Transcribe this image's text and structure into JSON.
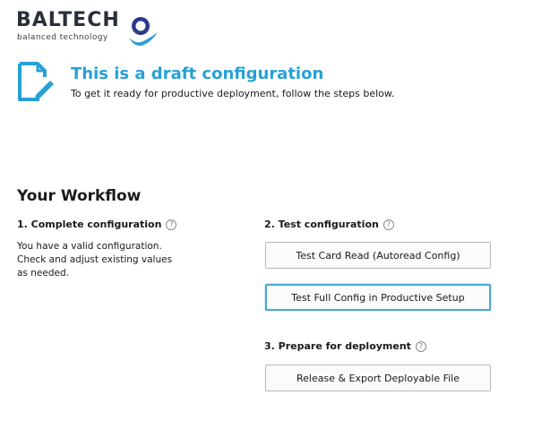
{
  "logo": {
    "name": "BALTECH",
    "tagline": "balanced technology"
  },
  "draft": {
    "title": "This is a draft configuration",
    "subtitle": "To get it ready for productive deployment, follow the steps below.",
    "icon": "edit-document-icon"
  },
  "workflow": {
    "title": "Your Workflow",
    "steps": [
      {
        "heading": "1. Complete configuration",
        "lines": [
          "You have a valid configuration.",
          "Check and adjust existing values",
          "as needed."
        ]
      },
      {
        "heading": "2. Test configuration",
        "buttons": [
          "Test Card Read (Autoread Config)",
          "Test Full Config in Productive Setup"
        ]
      },
      {
        "heading": "3. Prepare for deployment",
        "buttons": [
          "Release & Export Deployable File"
        ]
      }
    ],
    "help_glyph": "?"
  },
  "colors": {
    "accent": "#27a0d6",
    "logo_text": "#2a2f3a",
    "focus_border": "#4aa8d8"
  }
}
